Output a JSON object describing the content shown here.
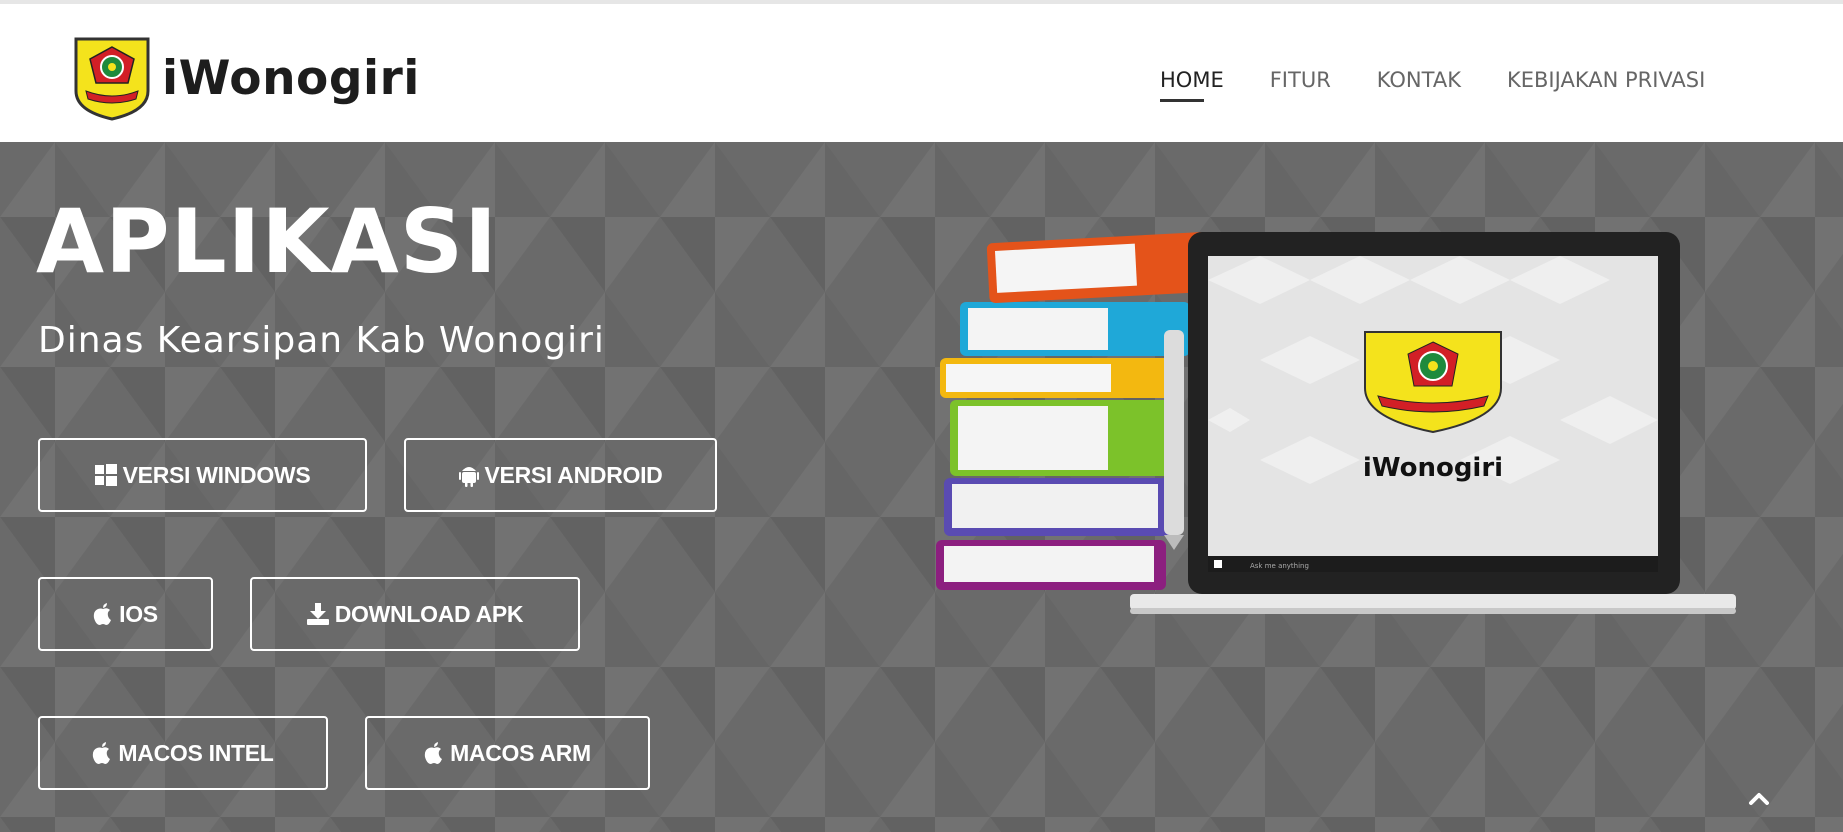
{
  "header": {
    "brand_name": "iWonogiri",
    "nav": [
      {
        "label": "HOME",
        "active": true
      },
      {
        "label": "FITUR",
        "active": false
      },
      {
        "label": "KONTAK",
        "active": false
      },
      {
        "label": "KEBIJAKAN PRIVASI",
        "active": false
      }
    ]
  },
  "hero": {
    "title": "APLIKASI",
    "subtitle": "Dinas Kearsipan Kab Wonogiri",
    "buttons": [
      {
        "label": "VERSI WINDOWS",
        "icon": "windows-icon"
      },
      {
        "label": "VERSI ANDROID",
        "icon": "android-icon"
      },
      {
        "label": "IOS",
        "icon": "apple-icon"
      },
      {
        "label": "DOWNLOAD APK",
        "icon": "download-icon"
      },
      {
        "label": "MACOS INTEL",
        "icon": "apple-icon"
      },
      {
        "label": "MACOS ARM",
        "icon": "apple-icon"
      }
    ],
    "laptop_screen_brand": "iWonogiri",
    "laptop_taskbar_text": "Ask me anything"
  },
  "colors": {
    "hero_bg": "#6b6b6b",
    "emblem_yellow": "#f4e31c",
    "emblem_red": "#d21f26",
    "emblem_green": "#1e8a3c"
  },
  "scroll_top_icon": "chevron-up-icon"
}
